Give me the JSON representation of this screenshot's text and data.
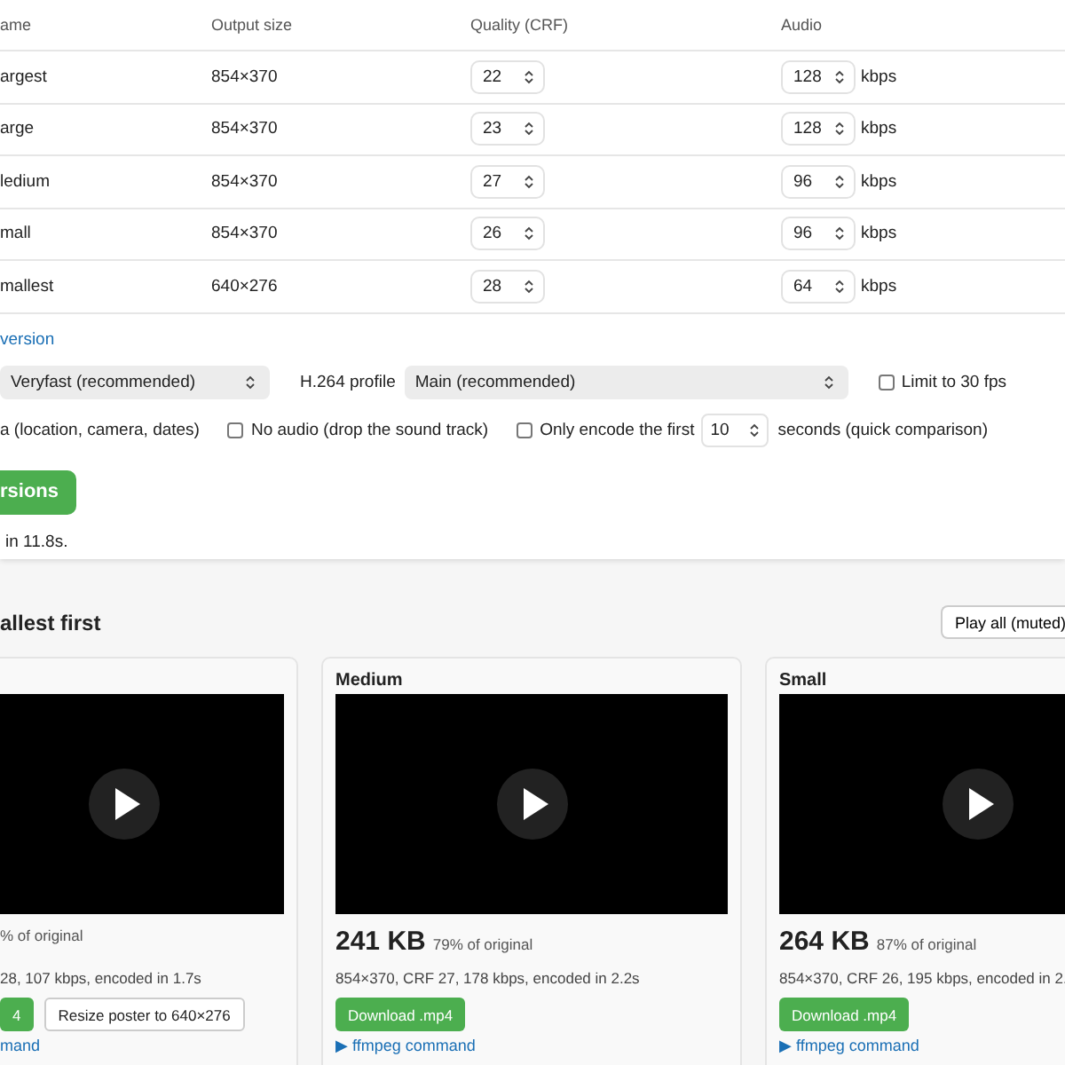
{
  "table": {
    "columns": [
      "ame",
      "Output size",
      "Quality (CRF)",
      "Audio"
    ],
    "rows": [
      {
        "name": "argest",
        "size": "854×370",
        "crf": "22",
        "audio": "128",
        "unit": "kbps"
      },
      {
        "name": "arge",
        "size": "854×370",
        "crf": "23",
        "audio": "128",
        "unit": "kbps"
      },
      {
        "name": "ledium",
        "size": "854×370",
        "crf": "27",
        "audio": "96",
        "unit": "kbps"
      },
      {
        "name": "mall",
        "size": "854×370",
        "crf": "26",
        "audio": "96",
        "unit": "kbps"
      },
      {
        "name": "mallest",
        "size": "640×276",
        "crf": "28",
        "audio": "64",
        "unit": "kbps"
      }
    ]
  },
  "options_link": "version",
  "preset": {
    "value": "Veryfast (recommended)"
  },
  "profile": {
    "label": "H.264 profile",
    "value": "Main (recommended)"
  },
  "limit_fps": {
    "label": "Limit to 30 fps",
    "checked": false
  },
  "metadata_text": "a (location, camera, dates)",
  "no_audio": {
    "label": "No audio (drop the sound track)",
    "checked": false
  },
  "encode_first": {
    "label": "Only encode the first",
    "checked": false,
    "value": "10",
    "suffix": "seconds (quick comparison)"
  },
  "convert_button": "rsions",
  "status": "in 11.8s.",
  "results": {
    "title": "allest first",
    "play_all": "Play all (muted)",
    "cards": [
      {
        "percent": "% of original",
        "meta": "28, 107 kbps, encoded in 1.7s",
        "buttons": [
          {
            "label": "4",
            "kind": "primary"
          },
          {
            "label": "Resize poster to 640×276",
            "kind": "secondary"
          }
        ],
        "link": "mand"
      },
      {
        "title": "Medium",
        "size": "241 KB",
        "percent": "79% of original",
        "meta": "854×370, CRF 27, 178 kbps, encoded in 2.2s",
        "buttons": [
          {
            "label": "Download .mp4",
            "kind": "primary"
          }
        ],
        "link": "▶ ffmpeg command"
      },
      {
        "title": "Small",
        "size": "264 KB",
        "percent": "87% of original",
        "meta": "854×370, CRF 26, 195 kbps, encoded in 2.",
        "buttons": [
          {
            "label": "Download .mp4",
            "kind": "primary"
          }
        ],
        "link": "▶ ffmpeg command"
      }
    ]
  }
}
